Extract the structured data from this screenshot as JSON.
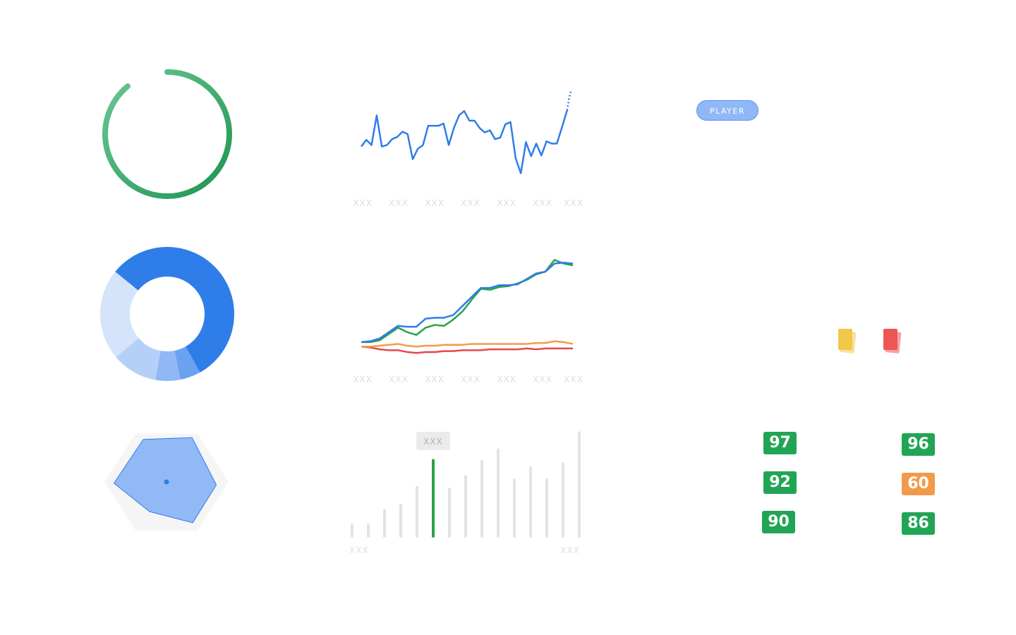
{
  "progress_ring": {
    "value": 0.89,
    "color_start": "#6cc795",
    "color_end": "#1e9550"
  },
  "player_pill": {
    "label": "PLAYER"
  },
  "cards": [
    {
      "name": "yellow-card",
      "color": "#f2c84b"
    },
    {
      "name": "red-card",
      "color": "#ec5656"
    }
  ],
  "ratings": [
    {
      "value": "97",
      "color": "#21a555"
    },
    {
      "value": "92",
      "color": "#21a555"
    },
    {
      "value": "90",
      "color": "#21a555"
    },
    {
      "value": "96",
      "color": "#21a555"
    },
    {
      "value": "60",
      "color": "#f29a4a"
    },
    {
      "value": "86",
      "color": "#21a555"
    }
  ],
  "chart_data": [
    {
      "type": "pie",
      "subtype": "donut",
      "values": [
        56,
        5,
        6,
        11,
        22
      ],
      "colors": [
        "#2f7de9",
        "#6aa2f0",
        "#8fb8f5",
        "#b5d0f8",
        "#d5e4fb"
      ]
    },
    {
      "type": "radar",
      "background_color": "#f5f5f5",
      "fill_color": "#91b9f5",
      "stroke_color": "#2f7de9",
      "values": [
        0.8,
        0.88,
        0.87,
        0.79,
        0.88,
        0.94
      ]
    },
    {
      "type": "line",
      "tick_labels": [
        "XXX",
        "XXX",
        "XXX",
        "XXX",
        "XXX",
        "XXX",
        "XXX"
      ],
      "color": "#2f7de9",
      "values": [
        46,
        55,
        48,
        88,
        46,
        48,
        56,
        59,
        66,
        63,
        29,
        43,
        48,
        74,
        74,
        74,
        77,
        48,
        71,
        88,
        94,
        81,
        81,
        71,
        65,
        68,
        56,
        58,
        76,
        79,
        30,
        10,
        52,
        33,
        50,
        34,
        53,
        50,
        50,
        72,
        95
      ],
      "projected": [
        95,
        110,
        120
      ]
    },
    {
      "type": "line",
      "tick_labels": [
        "XXX",
        "XXX",
        "XXX",
        "XXX",
        "XXX",
        "XXX",
        "XXX"
      ],
      "ylim": [
        0,
        100
      ],
      "series": [
        {
          "color": "#2f7de9",
          "values": [
            4,
            5,
            8,
            15,
            22,
            21,
            21,
            30,
            31,
            31,
            34,
            44,
            54,
            64,
            64,
            67,
            67,
            68,
            74,
            80,
            82,
            91,
            92,
            91
          ]
        },
        {
          "color": "#2aa14a",
          "values": [
            4,
            4,
            6,
            13,
            20,
            15,
            12,
            20,
            23,
            22,
            29,
            38,
            51,
            63,
            62,
            65,
            66,
            69,
            73,
            79,
            82,
            95,
            91,
            89
          ]
        },
        {
          "color": "#f29a4a",
          "values": [
            -1,
            -1,
            0,
            1,
            2,
            0,
            -1,
            0,
            0,
            1,
            1,
            1,
            2,
            2,
            2,
            2,
            2,
            2,
            2,
            3,
            3,
            5,
            4,
            2
          ]
        },
        {
          "color": "#e5484d",
          "values": [
            -1,
            -2,
            -4,
            -5,
            -5,
            -7,
            -8,
            -7,
            -7,
            -6,
            -6,
            -5,
            -5,
            -5,
            -4,
            -4,
            -4,
            -4,
            -3,
            -4,
            -3,
            -3,
            -3,
            -3
          ]
        }
      ]
    },
    {
      "type": "bar",
      "tick_labels": [
        "XXX",
        "XXX"
      ],
      "tooltip": "XXX",
      "highlight_index": 5,
      "highlight_color": "#2aa14a",
      "bar_color": "#e3e3e3",
      "values": [
        16,
        16,
        32,
        38,
        58,
        88,
        56,
        70,
        87,
        100,
        66,
        80,
        66,
        84,
        119
      ],
      "ylim": [
        0,
        120
      ]
    }
  ]
}
